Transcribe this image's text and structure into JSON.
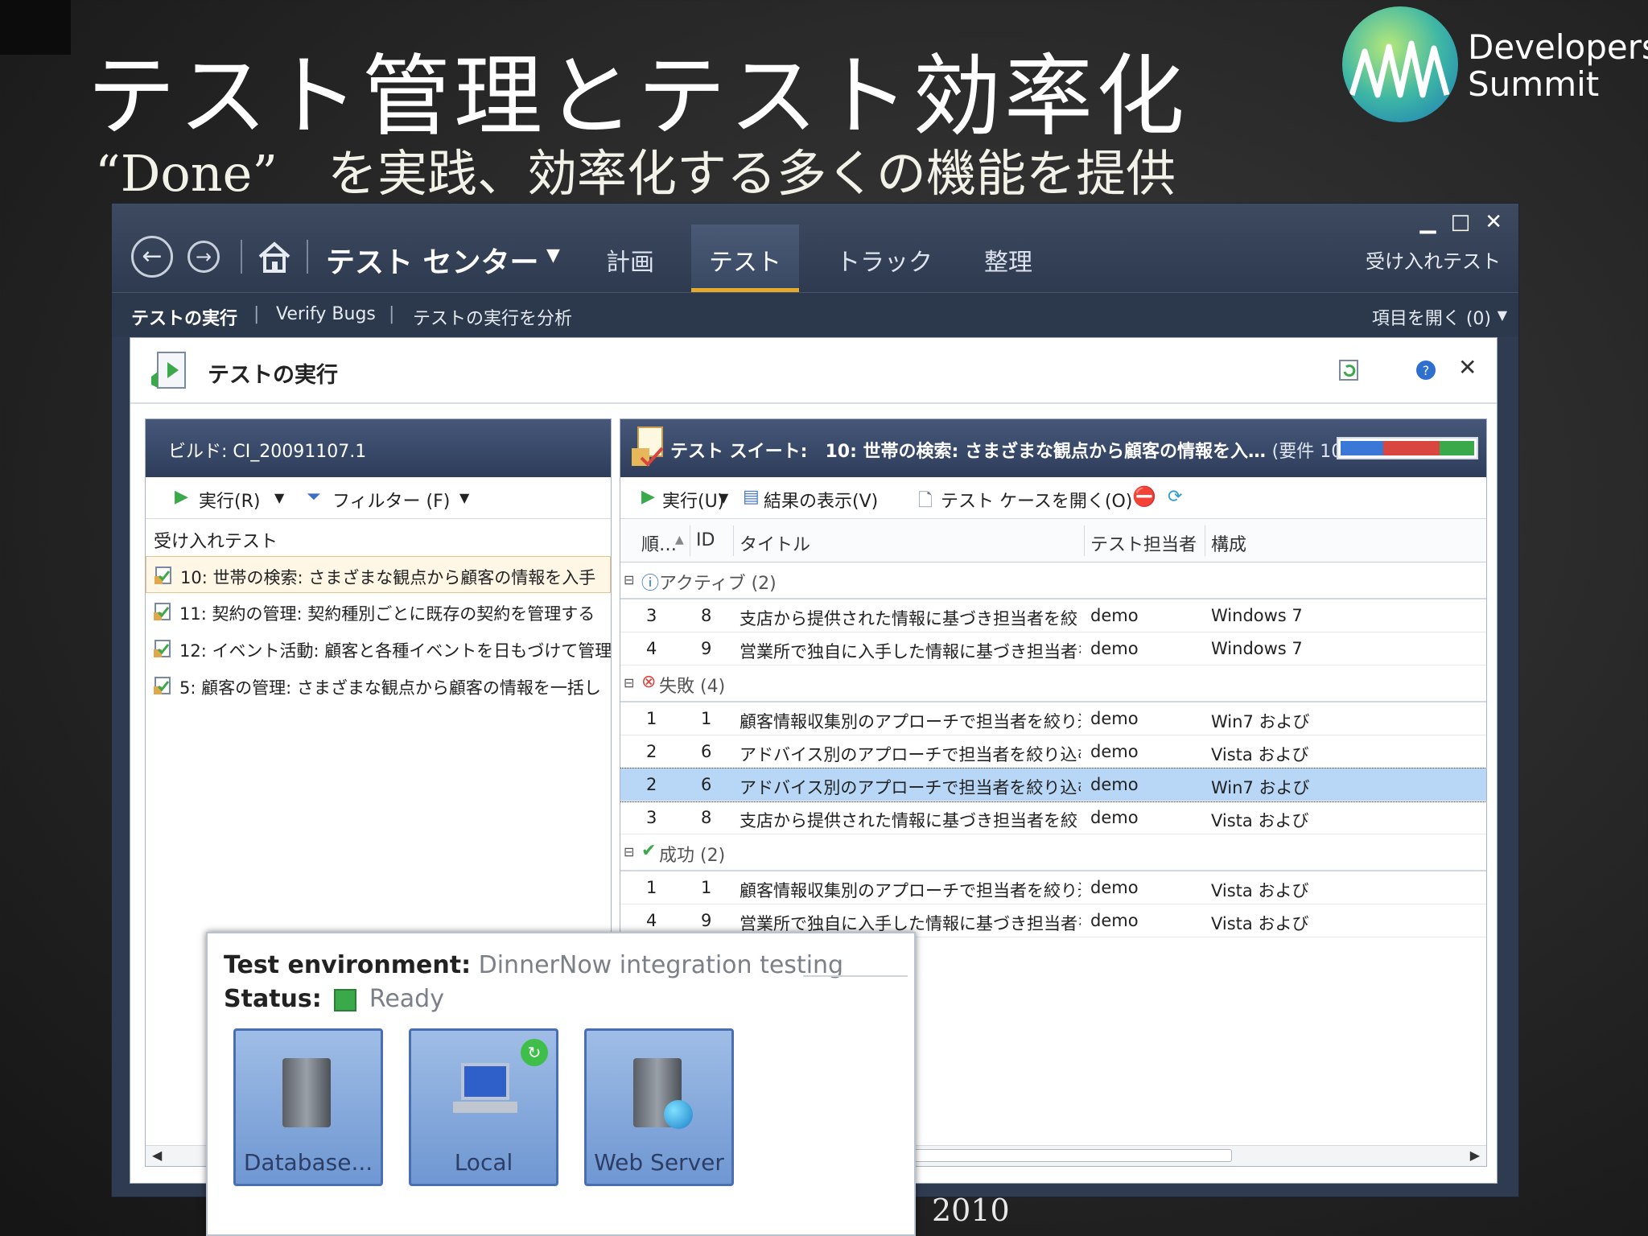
{
  "slide": {
    "title": "テスト管理とテスト効率化",
    "subtitle": "“Done”　を実践、効率化する多くの機能を提供",
    "year": "2010"
  },
  "logo": {
    "line1": "Developers",
    "line2": "Summit"
  },
  "window": {
    "controls": [
      "▁",
      "□",
      "✕"
    ],
    "app_title": "テスト センター",
    "tabs": [
      "計画",
      "テスト",
      "トラック",
      "整理"
    ],
    "active_tab": "テスト",
    "accept_link": "受け入れテスト",
    "subnav": [
      "テストの実行",
      "Verify Bugs",
      "テストの実行を分析"
    ],
    "open_items": "項目を開く (0)"
  },
  "panel": {
    "title": "テストの実行",
    "left": {
      "build": "ビルド: CI_20091107.1",
      "run_label": "実行(R)",
      "filter_label": "フィルター (F)",
      "root": "受け入れテスト",
      "items": [
        "10: 世帯の検索: さまざまな観点から顧客の情報を入手",
        "11: 契約の管理: 契約種別ごとに既存の契約を管理する",
        "12: イベント活動: 顧客と各種イベントを日もづけて管理",
        "5: 顧客の管理: さまざまな観点から顧客の情報を一括し"
      ]
    },
    "right": {
      "suite_title": "テスト スイート:　10: 世帯の検索: さまざまな観点から顧客の情報を入…",
      "requirement": "(要件 10)",
      "progress": {
        "active": 0.32,
        "failed": 0.42,
        "passed": 0.26
      },
      "toolbar": {
        "run": "実行(U)",
        "show_results": "結果の表示(V)",
        "open_case": "テスト ケースを開く(O)"
      },
      "columns": [
        "順…",
        "ID",
        "タイトル",
        "テスト担当者",
        "構成"
      ],
      "groups": [
        {
          "label": "アクティブ (2)",
          "icon": "info-icon",
          "rows": [
            [
              "3",
              "8",
              "支店から提供された情報に基づき担当者を絞り込む (販…",
              "demo",
              "Windows 7"
            ],
            [
              "4",
              "9",
              "営業所で独自に入手した情報に基づき担当者を絞り込む…",
              "demo",
              "Windows 7"
            ]
          ]
        },
        {
          "label": "失敗 (4)",
          "icon": "fail-icon",
          "rows": [
            [
              "1",
              "1",
              "顧客情報収集別のアプローチで担当者を絞り込む",
              "demo",
              "Win7 および"
            ],
            [
              "2",
              "6",
              "アドバイス別のアプローチで担当者を絞り込む",
              "demo",
              "Vista および"
            ],
            [
              "2",
              "6",
              "アドバイス別のアプローチで担当者を絞り込む",
              "demo",
              "Win7 および"
            ],
            [
              "3",
              "8",
              "支店から提供された情報に基づき担当者を絞り込む (販…",
              "demo",
              "Vista および"
            ]
          ]
        },
        {
          "label": "成功 (2)",
          "icon": "pass-icon",
          "rows": [
            [
              "1",
              "1",
              "顧客情報収集別のアプローチで担当者を絞り込む",
              "demo",
              "Vista および"
            ],
            [
              "4",
              "9",
              "営業所で独自に入手した情報に基づき担当者を絞り込む…",
              "demo",
              "Vista および"
            ]
          ]
        }
      ]
    }
  },
  "environment": {
    "env_label": "Test environment:",
    "env_value": "DinnerNow integration testing",
    "status_label": "Status:",
    "status_value": "Ready",
    "machines": [
      "Database...",
      "Local",
      "Web Server"
    ]
  },
  "colors": {
    "active": "#3a78d8",
    "failed": "#d9463f",
    "passed": "#3aa94a",
    "tab_accent": "#e5a92c"
  }
}
